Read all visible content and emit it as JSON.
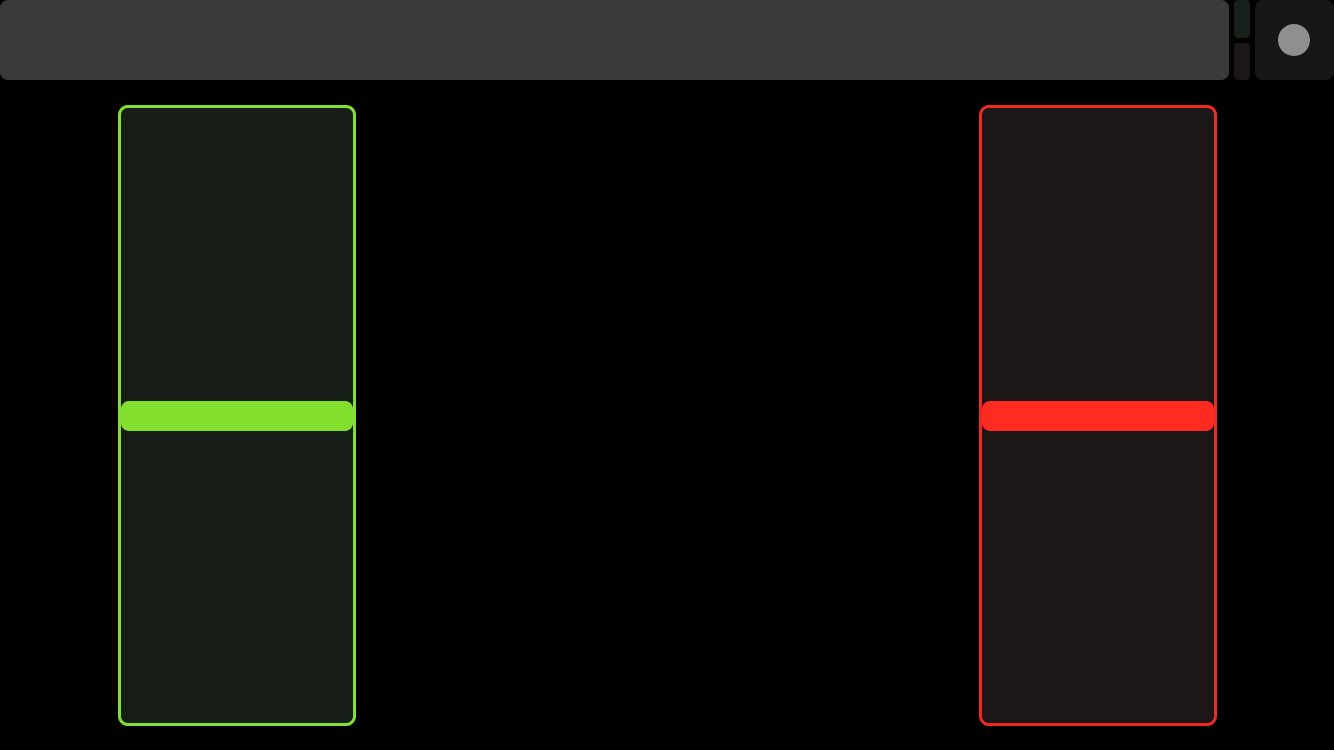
{
  "colors": {
    "top_bar": "#3a3a3a",
    "indicator_top": "#172119",
    "indicator_bottom": "#1c1717",
    "menu_button_bg": "#171717",
    "menu_dot": "#8f8f8f"
  },
  "faders": [
    {
      "id": "left",
      "border_color": "#84e02e",
      "track_color": "#171d17",
      "handle_color": "#84e02e",
      "value": 0.5
    },
    {
      "id": "right",
      "border_color": "#f02a20",
      "track_color": "#1c1616",
      "handle_color": "#ff2b20",
      "value": 0.5
    }
  ]
}
